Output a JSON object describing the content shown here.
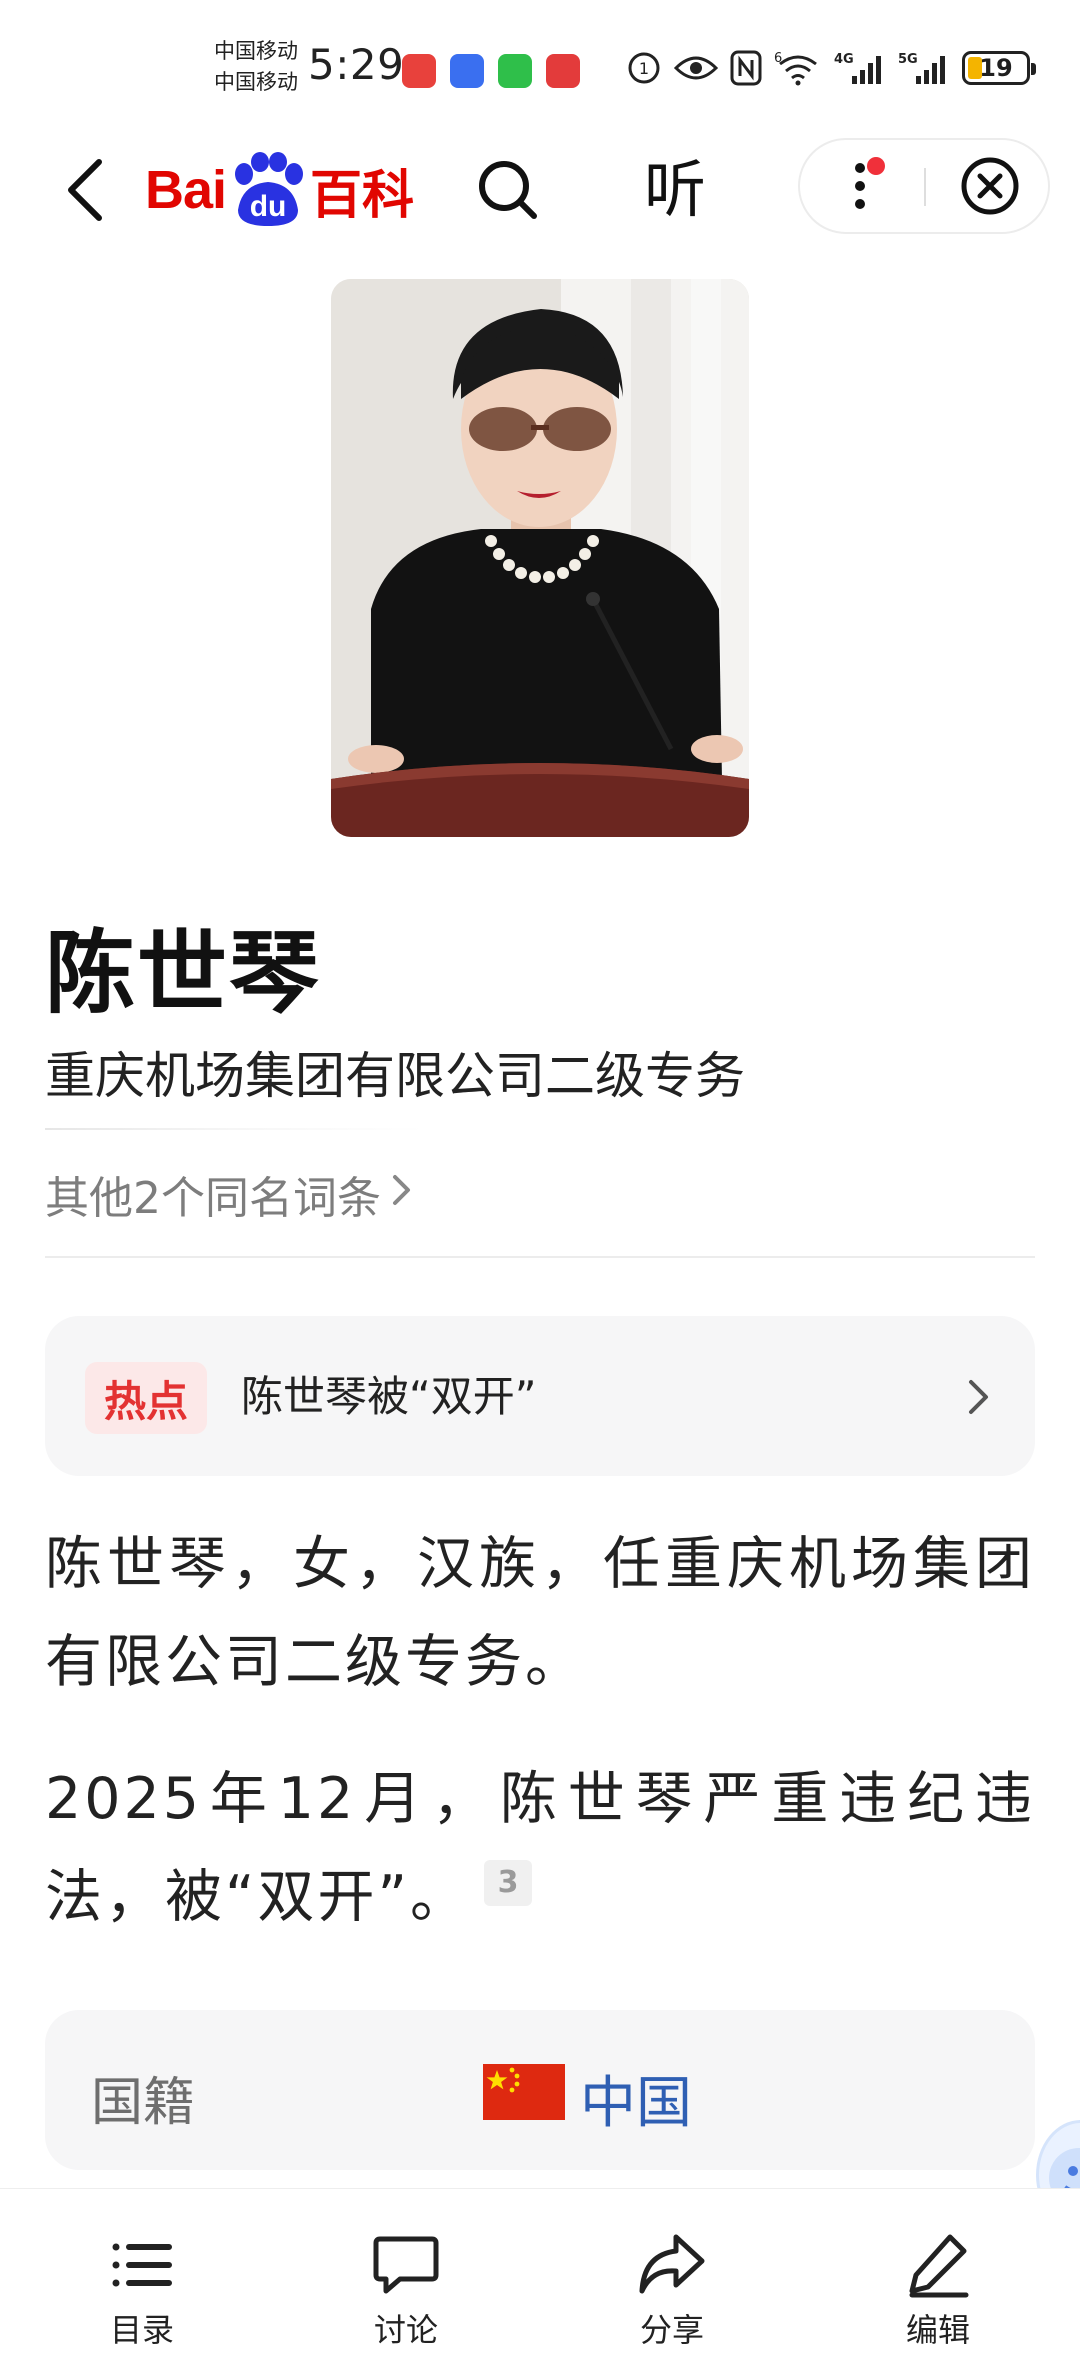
{
  "status_bar": {
    "carrier_1": "中国移动",
    "carrier_2": "中国移动",
    "time": "5:29",
    "network_1": "6",
    "network_2": "4G",
    "network_3": "5G",
    "battery": "19"
  },
  "header": {
    "logo_bai": "Bai",
    "logo_du": "du",
    "logo_baike": "百科",
    "listen_label": "听"
  },
  "article": {
    "title": "陈世琴",
    "subtitle": "重庆机场集团有限公司二级专务",
    "synonyms": "其他2个同名词条"
  },
  "hot": {
    "badge": "热点",
    "text": "陈世琴被“双开”"
  },
  "body": {
    "para1": "陈世琴，女，汉族，任重庆机场集团有限公司二级专务。",
    "para2": "2025年12月，陈世琴严重违纪违法，被“双开”。",
    "ref": "3"
  },
  "info": {
    "label": "国籍",
    "value": "中国"
  },
  "toolbar": {
    "toc": "目录",
    "discuss": "讨论",
    "share": "分享",
    "edit": "编辑"
  },
  "colors": {
    "brand_red": "#e10601",
    "brand_blue": "#2932e1",
    "link_blue": "#2f5fb3",
    "hot_red": "#e33232"
  }
}
